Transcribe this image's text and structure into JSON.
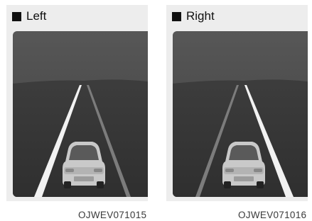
{
  "panels": [
    {
      "title": "Left",
      "code": "OJWEV071015",
      "highlighted_lane_line": "left"
    },
    {
      "title": "Right",
      "code": "OJWEV071016",
      "highlighted_lane_line": "right"
    }
  ],
  "icons": {
    "title_marker": "black-square-icon"
  },
  "colors": {
    "panel_background": "#ededed",
    "sky": "#4a4a4a",
    "road": "#3a3a3a",
    "highlight_line": "#ffffff",
    "normal_line": "#8a8a8a"
  }
}
